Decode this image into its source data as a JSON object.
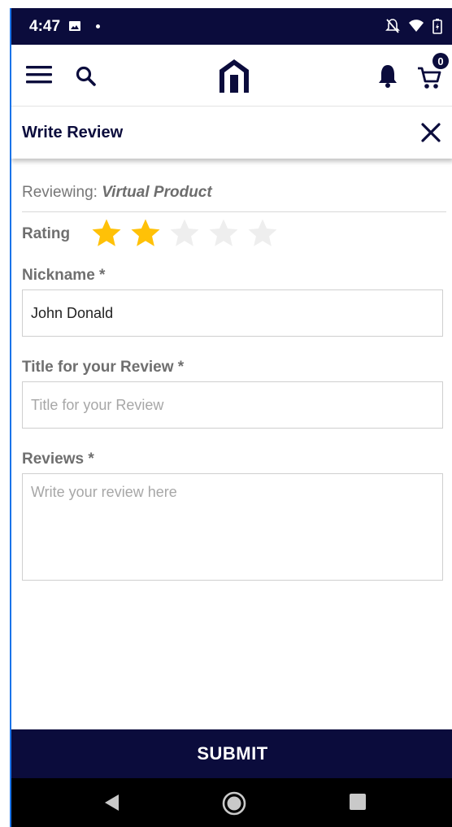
{
  "status_bar": {
    "time": "4:47",
    "icons": [
      "image-icon",
      "dot-icon",
      "bell-off-icon",
      "wifi-icon",
      "battery-icon"
    ]
  },
  "app_bar": {
    "icons": [
      "menu-icon",
      "search-icon",
      "logo-icon",
      "bell-icon",
      "cart-icon"
    ],
    "cart_count": "0"
  },
  "review_bar": {
    "title": "Write Review",
    "close_icon": "close-icon"
  },
  "form": {
    "reviewing_prefix": "Reviewing: ",
    "product_name": "Virtual Product",
    "rating_label": "Rating",
    "rating": {
      "value": 2,
      "max": 5,
      "filled_color": "#ffc107",
      "empty_color": "#eeeeee"
    },
    "nickname_label": "Nickname *",
    "nickname_value": "John Donald",
    "title_label": "Title for your Review *",
    "title_placeholder": "Title for your Review",
    "title_value": "",
    "reviews_label": "Reviews *",
    "reviews_placeholder": "Write your review here",
    "reviews_value": ""
  },
  "submit_label": "SUBMIT",
  "nav_bar": {
    "icons": [
      "back-icon",
      "home-icon",
      "recents-icon"
    ]
  },
  "colors": {
    "primary": "#0b0c3c",
    "star": "#ffc107"
  }
}
